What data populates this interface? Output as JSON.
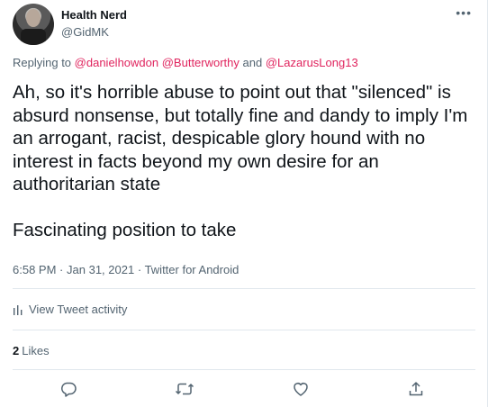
{
  "author": {
    "name": "Health Nerd",
    "handle": "@GidMK"
  },
  "more_icon": "more-horizontal-icon",
  "reply": {
    "prefix": "Replying to",
    "mention1": "@danielhowdon",
    "mention2": "@Butterworthy",
    "conjunction": "and",
    "mention3": "@LazarusLong13",
    "mention_color": "#e0245e"
  },
  "tweet": {
    "text": "Ah, so it's horrible abuse to point out that \"silenced\" is absurd nonsense, but totally fine and dandy to imply I'm an arrogant, racist, despicable glory hound with no interest in facts beyond my own desire for an authoritarian state\n\nFascinating position to take"
  },
  "meta": {
    "time": "6:58 PM",
    "separator": "·",
    "date": "Jan 31, 2021",
    "source": "Twitter for Android"
  },
  "activity": {
    "label": "View Tweet activity",
    "icon": "bar-chart-icon"
  },
  "likes": {
    "count": "2",
    "label": "Likes"
  },
  "actions": {
    "reply_icon": "reply-icon",
    "retweet_icon": "retweet-icon",
    "like_icon": "heart-icon",
    "share_icon": "share-icon"
  },
  "colors": {
    "text": "#0f1419",
    "secondary": "#536471",
    "divider": "#e1e8ed"
  }
}
